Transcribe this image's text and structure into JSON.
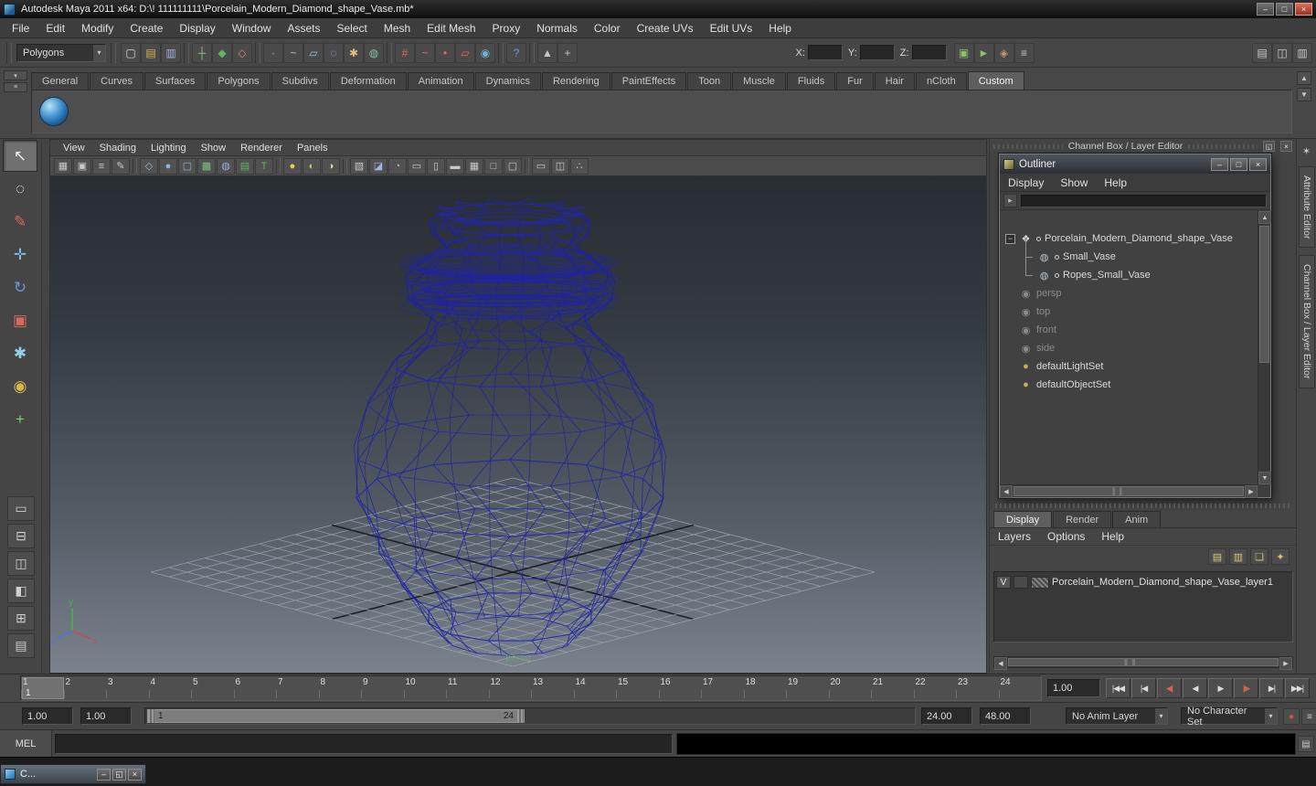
{
  "glyphs": {
    "minimize": "–",
    "maximize": "□",
    "restore": "◱",
    "close": "×",
    "up": "▲",
    "down": "▼",
    "left": "◀",
    "right": "▶",
    "dropdown": "▾"
  },
  "colors": {
    "wireframe": "#2226ae",
    "close_button": "#b0402f",
    "viewport_top": "#282d33",
    "viewport_bottom": "#7a828d"
  },
  "titlebar": {
    "title": "Autodesk Maya 2011 x64: D:\\! 111111111\\Porcelain_Modern_Diamond_shape_Vase.mb*"
  },
  "menubar": {
    "items": [
      "File",
      "Edit",
      "Modify",
      "Create",
      "Display",
      "Window",
      "Assets",
      "Select",
      "Mesh",
      "Edit Mesh",
      "Proxy",
      "Normals",
      "Color",
      "Create UVs",
      "Edit UVs",
      "Help"
    ]
  },
  "statusline": {
    "mode_selector": "Polygons",
    "icons": [
      {
        "name": "new-scene",
        "glyph": "▢",
        "color": "#d9d9d9"
      },
      {
        "name": "open-scene",
        "glyph": "▤",
        "color": "#d9b24a"
      },
      {
        "name": "save-scene",
        "glyph": "▥",
        "color": "#9fb6e0"
      },
      {
        "name": "select-by-hierarchy",
        "glyph": "┼",
        "color": "#8fc98f",
        "gap": true
      },
      {
        "name": "select-by-object-type",
        "glyph": "◆",
        "color": "#5cb85c"
      },
      {
        "name": "select-by-component-type",
        "glyph": "◇",
        "color": "#d98080"
      },
      {
        "name": "mask-points",
        "glyph": "∙",
        "color": "#e0a0a0",
        "gap": true
      },
      {
        "name": "mask-curves",
        "glyph": "~",
        "color": "#a0c0e0"
      },
      {
        "name": "mask-surfaces",
        "glyph": "▱",
        "color": "#a0c0e0"
      },
      {
        "name": "mask-deformers",
        "glyph": "◌",
        "color": "#c0a0e0"
      },
      {
        "name": "mask-dynamics",
        "glyph": "✱",
        "color": "#e0c080"
      },
      {
        "name": "mask-rendering",
        "glyph": "◍",
        "color": "#80c0a0"
      },
      {
        "name": "snap-to-grids",
        "glyph": "#",
        "color": "#e06a5a",
        "gap": true
      },
      {
        "name": "snap-to-curves",
        "glyph": "~",
        "color": "#e06a5a"
      },
      {
        "name": "snap-to-points",
        "glyph": "•",
        "color": "#e06a5a"
      },
      {
        "name": "snap-to-view-planes",
        "glyph": "▱",
        "color": "#e06a5a"
      },
      {
        "name": "make-live",
        "glyph": "◉",
        "color": "#6ab0d8"
      },
      {
        "name": "help-line",
        "glyph": "?",
        "color": "#6a9ae0",
        "gap": true
      },
      {
        "name": "highlight-selection",
        "glyph": "▲",
        "color": "#c8c8c8",
        "gap": true
      },
      {
        "name": "construction-history",
        "glyph": "+",
        "color": "#c8c8c8"
      }
    ],
    "coord_fields": [
      {
        "label": "X:",
        "value": ""
      },
      {
        "label": "Y:",
        "value": ""
      },
      {
        "label": "Z:",
        "value": ""
      }
    ],
    "render_icons": [
      {
        "name": "open-render-view",
        "glyph": "▣",
        "color": "#8fbf6f"
      },
      {
        "name": "render-current-frame",
        "glyph": "►",
        "color": "#8fbf6f"
      },
      {
        "name": "ipr-render",
        "glyph": "◈",
        "color": "#bf9f6f"
      },
      {
        "name": "render-settings",
        "glyph": "≡",
        "color": "#c8c8c8"
      }
    ],
    "sidebar_toggles": [
      {
        "name": "show-attribute-editor",
        "glyph": "▤",
        "color": "#c9c9c9"
      },
      {
        "name": "show-tool-settings",
        "glyph": "◫",
        "color": "#c9c9c9"
      },
      {
        "name": "show-channel-box",
        "glyph": "▥",
        "color": "#c9c9c9"
      }
    ]
  },
  "shelf": {
    "tabs": [
      "General",
      "Curves",
      "Surfaces",
      "Polygons",
      "Subdivs",
      "Deformation",
      "Animation",
      "Dynamics",
      "Rendering",
      "PaintEffects",
      "Toon",
      "Muscle",
      "Fluids",
      "Fur",
      "Hair",
      "nCloth",
      "Custom"
    ],
    "active_tab": "Custom"
  },
  "toolbox": {
    "tools": [
      {
        "name": "select-tool",
        "glyph": "↖",
        "color": "#ececec",
        "active": true
      },
      {
        "name": "lasso-select-tool",
        "glyph": "◌",
        "color": "#ececec"
      },
      {
        "name": "paint-select-tool",
        "glyph": "✎",
        "color": "#d86a5a"
      },
      {
        "name": "move-tool",
        "glyph": "✛",
        "color": "#7ac0e8"
      },
      {
        "name": "rotate-tool",
        "glyph": "↻",
        "color": "#6a9ae0"
      },
      {
        "name": "scale-tool",
        "glyph": "▣",
        "color": "#d86a5a"
      },
      {
        "name": "universal-manipulator-tool",
        "glyph": "✱",
        "color": "#8fd0e8"
      },
      {
        "name": "soft-modification-tool",
        "glyph": "◉",
        "color": "#d8b84a"
      },
      {
        "name": "show-manipulator-tool",
        "glyph": "+",
        "color": "#7ad07a"
      },
      {
        "name": "last-tool",
        "glyph": "",
        "color": "#9a9a9a"
      }
    ],
    "layouts": [
      {
        "name": "layout-single-pane",
        "glyph": "▭"
      },
      {
        "name": "layout-two-pane-stacked",
        "glyph": "⊟"
      },
      {
        "name": "layout-two-pane-side",
        "glyph": "◫"
      },
      {
        "name": "layout-three-pane",
        "glyph": "◧"
      },
      {
        "name": "layout-four-pane",
        "glyph": "⊞"
      },
      {
        "name": "layout-outliner-persp",
        "glyph": "▤"
      }
    ]
  },
  "viewport": {
    "menus": [
      "View",
      "Shading",
      "Lighting",
      "Show",
      "Renderer",
      "Panels"
    ],
    "camera_label": "persp",
    "axis_labels": {
      "x": "x",
      "y": "y",
      "z": "z"
    },
    "toolbar_icons": [
      {
        "name": "select-camera",
        "glyph": "▦",
        "color": "#c9c9c9"
      },
      {
        "name": "lock-camera",
        "glyph": "▣",
        "color": "#c9c9c9"
      },
      {
        "name": "camera-attributes",
        "glyph": "≡",
        "color": "#c9c9c9"
      },
      {
        "name": "grease-pencil",
        "glyph": "✎",
        "color": "#c9c9c9"
      },
      {
        "name": "wireframe-mode",
        "glyph": "◇",
        "color": "#8fb6d9",
        "gap": true
      },
      {
        "name": "smooth-shade-mode",
        "glyph": "●",
        "color": "#8fb6d9"
      },
      {
        "name": "bounding-box-mode",
        "glyph": "▢",
        "color": "#8fb6d9"
      },
      {
        "name": "textured-mode",
        "glyph": "▩",
        "color": "#7ac07a"
      },
      {
        "name": "use-default-material",
        "glyph": "◍",
        "color": "#8fb6d9"
      },
      {
        "name": "color-management",
        "glyph": "▤",
        "color": "#5cb85c"
      },
      {
        "name": "texture-view",
        "glyph": "T",
        "color": "#5cb85c"
      },
      {
        "name": "use-all-lights",
        "glyph": "●",
        "color": "#e8d44a",
        "gap": true
      },
      {
        "name": "shadows-toggle",
        "glyph": "◐",
        "color": "#cdbd6a"
      },
      {
        "name": "screen-space-ao",
        "glyph": "◑",
        "color": "#d8d8a0"
      },
      {
        "name": "isolate-select",
        "glyph": "▧",
        "color": "#c9c9c9",
        "gap": true
      },
      {
        "name": "xray-mode",
        "glyph": "◪",
        "color": "#9fb6e0"
      },
      {
        "name": "wireframe-on-shaded",
        "glyph": "◔",
        "color": "#9fb6e0"
      },
      {
        "name": "film-gate",
        "glyph": "▭",
        "color": "#c9c9c9"
      },
      {
        "name": "resolution-gate",
        "glyph": "▯",
        "color": "#c9c9c9"
      },
      {
        "name": "gate-mask",
        "glyph": "▬",
        "color": "#c9c9c9"
      },
      {
        "name": "field-chart",
        "glyph": "▦",
        "color": "#c9c9c9"
      },
      {
        "name": "safe-action",
        "glyph": "□",
        "color": "#c9c9c9"
      },
      {
        "name": "safe-title",
        "glyph": "▢",
        "color": "#c9c9c9"
      },
      {
        "name": "single-pane-layout",
        "glyph": "▭",
        "color": "#c9c9c9",
        "gap": true
      },
      {
        "name": "two-pane-layout",
        "glyph": "◫",
        "color": "#c9c9c9"
      },
      {
        "name": "panel-share",
        "glyph": "∴",
        "color": "#c9c9c9"
      }
    ]
  },
  "right_panel": {
    "header": "Channel Box / Layer Editor"
  },
  "outliner": {
    "title": "Outliner",
    "menus": [
      "Display",
      "Show",
      "Help"
    ],
    "items": [
      {
        "label": "Porcelain_Modern_Diamond_shape_Vase",
        "icon": "group",
        "expanded": true,
        "node": true
      },
      {
        "label": "Small_Vase",
        "icon": "mesh",
        "child": true,
        "node": true
      },
      {
        "label": "Ropes_Small_Vase",
        "icon": "mesh",
        "child": true,
        "last": true,
        "node": true
      },
      {
        "label": "persp",
        "icon": "camera",
        "muted": true
      },
      {
        "label": "top",
        "icon": "camera",
        "muted": true
      },
      {
        "label": "front",
        "icon": "camera",
        "muted": true
      },
      {
        "label": "side",
        "icon": "camera",
        "muted": true
      },
      {
        "label": "defaultLightSet",
        "icon": "set"
      },
      {
        "label": "defaultObjectSet",
        "icon": "set"
      }
    ]
  },
  "layer_editor": {
    "tabs": [
      "Display",
      "Render",
      "Anim"
    ],
    "active_tab": "Display",
    "menus": [
      "Layers",
      "Options",
      "Help"
    ],
    "toolbar_icons": [
      {
        "name": "create-empty-layer",
        "glyph": "▤"
      },
      {
        "name": "create-layer-assign-selected",
        "glyph": "▥"
      },
      {
        "name": "create-layer-from-selected",
        "glyph": "❏"
      },
      {
        "name": "layer-options",
        "glyph": "✦"
      }
    ],
    "layers": [
      {
        "visibility": "V",
        "name": "Porcelain_Modern_Diamond_shape_Vase_layer1"
      }
    ]
  },
  "side_tabs": {
    "items": [
      "Attribute Editor",
      "Channel Box / Layer Editor"
    ],
    "tool_icon": "✶"
  },
  "timeline": {
    "ticks": [
      "1",
      "2",
      "3",
      "4",
      "5",
      "6",
      "7",
      "8",
      "9",
      "10",
      "11",
      "12",
      "13",
      "14",
      "15",
      "16",
      "17",
      "18",
      "19",
      "20",
      "21",
      "22",
      "23",
      "24"
    ],
    "current_frame": "1",
    "current_time_field": "1.00",
    "playback": [
      {
        "name": "go-to-start",
        "glyph": "|◀◀"
      },
      {
        "name": "step-back-frame",
        "glyph": "|◀"
      },
      {
        "name": "step-back-key",
        "glyph": "◀|",
        "accent": true
      },
      {
        "name": "play-backwards",
        "glyph": "◀"
      },
      {
        "name": "play-forwards",
        "glyph": "▶"
      },
      {
        "name": "step-forward-key",
        "glyph": "|▶",
        "accent": true
      },
      {
        "name": "step-forward-frame",
        "glyph": "▶|"
      },
      {
        "name": "go-to-end",
        "glyph": "▶▶|"
      }
    ]
  },
  "range_slider": {
    "anim_start": "1.00",
    "playback_start": "1.00",
    "range_start_label": "1",
    "range_end_label": "24",
    "playback_end": "24.00",
    "anim_end": "48.00",
    "anim_layer": "No Anim Layer",
    "character_set": "No Character Set",
    "icons": [
      {
        "name": "auto-keyframe-toggle",
        "glyph": "●",
        "color": "#cc5544"
      },
      {
        "name": "animation-preferences",
        "glyph": "≡",
        "color": "#c9c9c9"
      }
    ]
  },
  "command_line": {
    "label": "MEL"
  },
  "taskbar": {
    "minimized_window_title": "C..."
  }
}
